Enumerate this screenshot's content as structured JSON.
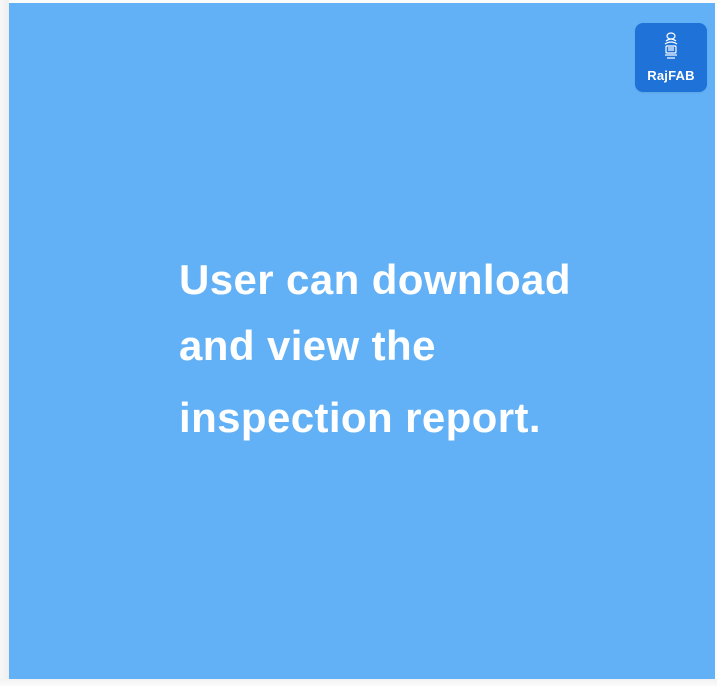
{
  "brand": {
    "logo_text": "RajFAB",
    "logo_icon": "state-emblem-icon",
    "logo_color": "#1f73d8"
  },
  "slide": {
    "background_color": "#62b1f6",
    "text_color": "#ffffff",
    "lines": [
      "User can download",
      "and view the",
      "inspection report."
    ]
  }
}
